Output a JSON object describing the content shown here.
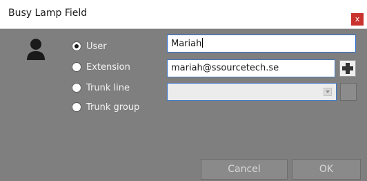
{
  "window": {
    "title": "Busy Lamp Field",
    "close_label": "x"
  },
  "options": {
    "items": [
      {
        "label": "User",
        "checked": true
      },
      {
        "label": "Extension",
        "checked": false
      },
      {
        "label": "Trunk line",
        "checked": false
      },
      {
        "label": "Trunk group",
        "checked": false
      }
    ]
  },
  "fields": {
    "name_value": "Mariah",
    "email_value": "mariah@ssourcetech.se",
    "select_value": ""
  },
  "icons": {
    "type_icon": "user-icon",
    "add": "plus-icon",
    "select_arrow": "chevron-down-icon"
  },
  "buttons": {
    "cancel_label": "Cancel",
    "ok_label": "OK"
  },
  "colors": {
    "dialog_bg": "#7f7f7f",
    "accent": "#3f78c8",
    "close": "#c9322d"
  }
}
